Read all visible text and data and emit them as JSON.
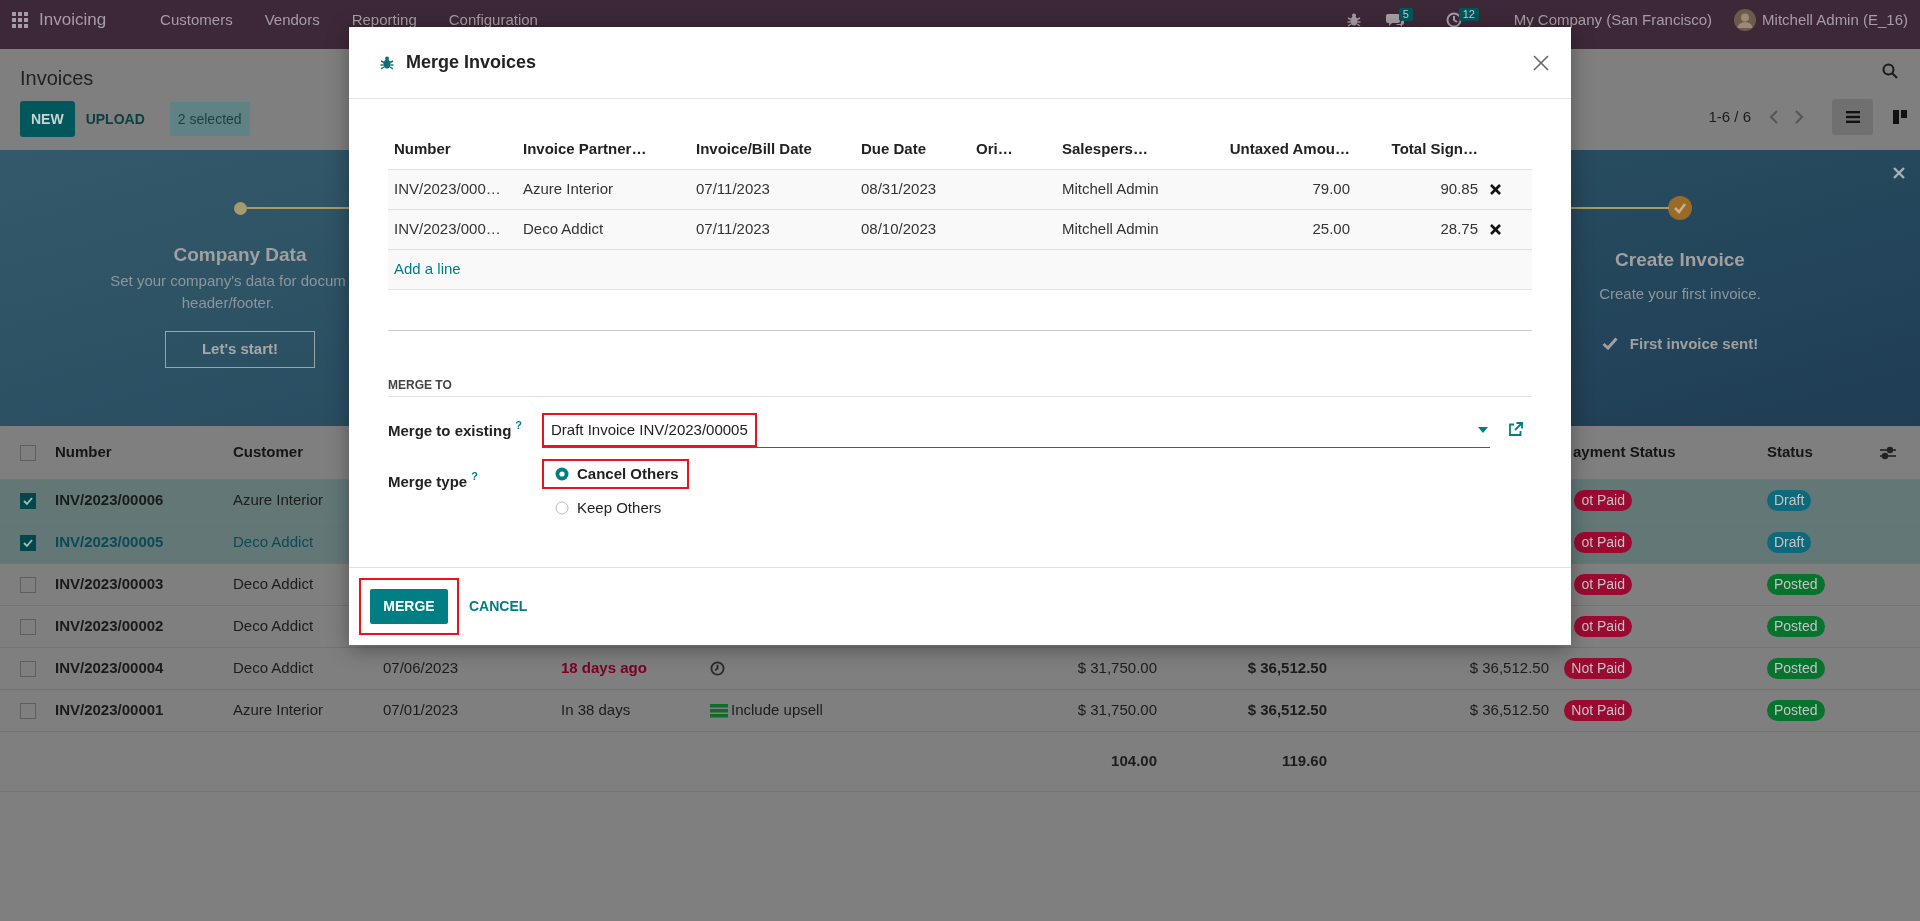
{
  "navbar": {
    "app_name": "Invoicing",
    "menu": [
      "Customers",
      "Vendors",
      "Reporting",
      "Configuration"
    ],
    "messages_count": "5",
    "activities_count": "12",
    "company": "My Company (San Francisco)",
    "user": "Mitchell Admin (E_16)"
  },
  "control_panel": {
    "title": "Invoices",
    "buttons": [
      {
        "label": "NEW",
        "kind": "primary"
      },
      {
        "label": "UPLOAD",
        "kind": "secondary"
      }
    ],
    "selection": "2 selected",
    "pager": "1-6 / 6",
    "views": [
      {
        "kind": "list",
        "selected": true
      },
      {
        "kind": "kanban",
        "selected": false
      }
    ]
  },
  "onboarding": {
    "steps": [
      {
        "title": "Company Data",
        "description_lines": [
          "Set your company's data for docum",
          "header/footer."
        ],
        "button": "Let's start!",
        "done": false
      },
      {
        "title": "Create Invoice",
        "description_lines": [
          "Create your first invoice."
        ],
        "done_label": "First invoice sent!",
        "done": true
      }
    ]
  },
  "invoices": {
    "columns": [
      "Number",
      "Customer",
      "ayment Status",
      "Status"
    ],
    "all_selected": false,
    "rows": [
      {
        "selected": true,
        "hovered": false,
        "number": "INV/2023/00006",
        "customer": "Azure Interior",
        "payment_status": "ot Paid",
        "status": {
          "label": "Draft",
          "kind": "draft"
        }
      },
      {
        "selected": true,
        "hovered": true,
        "number": "INV/2023/00005",
        "customer": "Deco Addict",
        "payment_status": "ot Paid",
        "status": {
          "label": "Draft",
          "kind": "draft"
        }
      },
      {
        "selected": false,
        "hovered": false,
        "number": "INV/2023/00003",
        "customer": "Deco Addict",
        "payment_status": "ot Paid",
        "status": {
          "label": "Posted",
          "kind": "posted"
        }
      },
      {
        "selected": false,
        "hovered": false,
        "number": "INV/2023/00002",
        "customer": "Deco Addict",
        "payment_status": "ot Paid",
        "status": {
          "label": "Posted",
          "kind": "posted"
        }
      },
      {
        "selected": false,
        "hovered": false,
        "number": "INV/2023/00004",
        "customer": "Deco Addict",
        "invoice_date": "07/06/2023",
        "due": {
          "label": "18 days ago",
          "overdue": true
        },
        "activity": {
          "kind": "clock"
        },
        "tax_excluded": "$ 31,750.00",
        "total": "$ 36,512.50",
        "total_signed": "$ 36,512.50",
        "payment_status": "Not Paid",
        "status": {
          "label": "Posted",
          "kind": "posted"
        }
      },
      {
        "selected": false,
        "hovered": false,
        "number": "INV/2023/00001",
        "customer": "Azure Interior",
        "invoice_date": "07/01/2023",
        "due": {
          "label": "In 38 days",
          "overdue": false
        },
        "activity": {
          "kind": "todo",
          "label": "Include upsell"
        },
        "tax_excluded": "$ 31,750.00",
        "total": "$ 36,512.50",
        "total_signed": "$ 36,512.50",
        "payment_status": "Not Paid",
        "status": {
          "label": "Posted",
          "kind": "posted"
        }
      }
    ],
    "totals": {
      "tax_excluded": "104.00",
      "total": "119.60"
    }
  },
  "dialog": {
    "title": "Merge Invoices",
    "lines": {
      "columns": [
        "Number",
        "Invoice Partner…",
        "Invoice/Bill Date",
        "Due Date",
        "Ori…",
        "Salespers…",
        "Untaxed Amou…",
        "Total Sign…"
      ],
      "rows": [
        {
          "number": "INV/2023/000…",
          "partner": "Azure Interior",
          "date": "07/11/2023",
          "due_date": "08/31/2023",
          "salesperson": "Mitchell Admin",
          "untaxed": "79.00",
          "total": "90.85"
        },
        {
          "number": "INV/2023/000…",
          "partner": "Deco Addict",
          "date": "07/11/2023",
          "due_date": "08/10/2023",
          "salesperson": "Mitchell Admin",
          "untaxed": "25.00",
          "total": "28.75"
        }
      ],
      "add_line": "Add a line"
    },
    "section": "MERGE TO",
    "fields": [
      {
        "kind": "many2one",
        "label": "Merge to existing",
        "help": "?",
        "value": "Draft Invoice INV/2023/00005",
        "highlighted": true
      },
      {
        "kind": "radio",
        "label": "Merge type",
        "help": "?",
        "options": [
          {
            "label": "Cancel Others",
            "selected": true,
            "highlighted": true
          },
          {
            "label": "Keep Others",
            "selected": false,
            "highlighted": false
          }
        ]
      }
    ],
    "buttons": [
      {
        "label": "MERGE",
        "kind": "primary",
        "highlighted": true
      },
      {
        "label": "CANCEL",
        "kind": "link",
        "highlighted": false
      }
    ]
  }
}
